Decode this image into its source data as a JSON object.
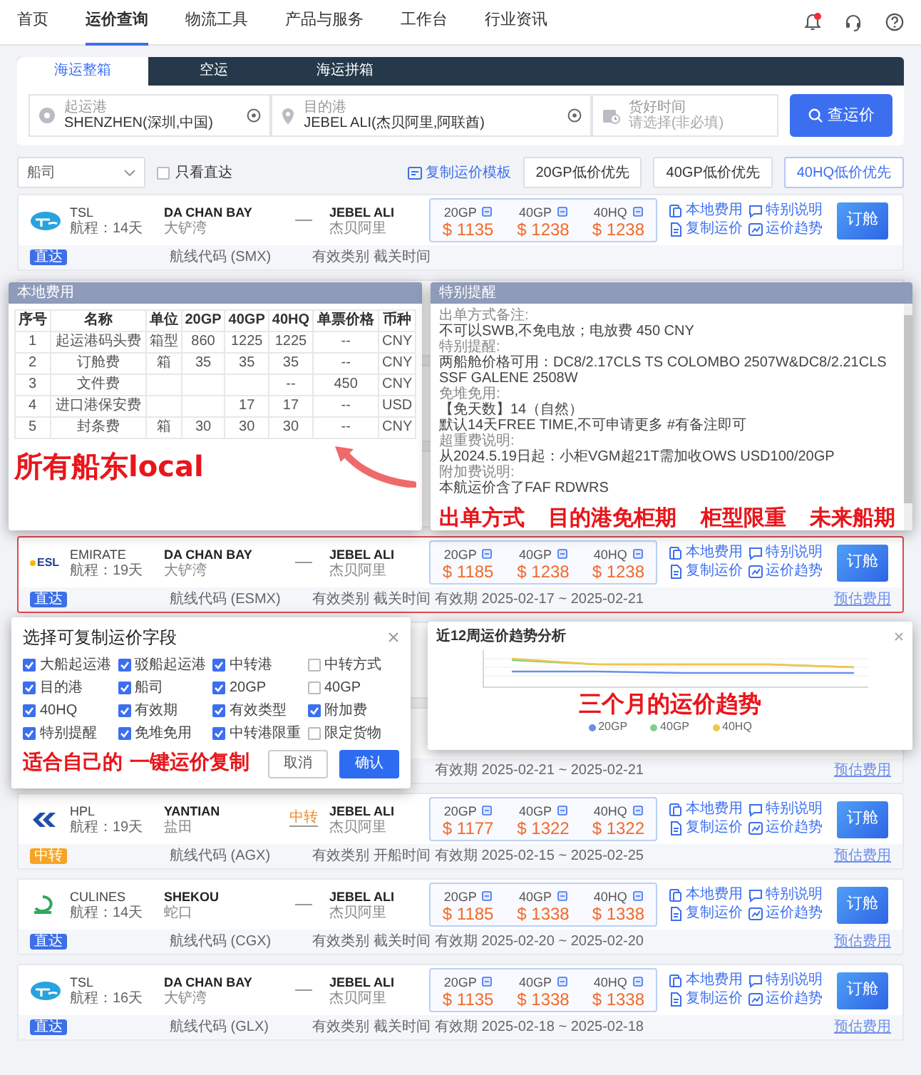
{
  "nav": {
    "items": [
      {
        "label": "首页",
        "selected": false
      },
      {
        "label": "运价查询",
        "selected": true
      },
      {
        "label": "物流工具",
        "selected": false
      },
      {
        "label": "产品与服务",
        "selected": false
      },
      {
        "label": "工作台",
        "selected": false
      },
      {
        "label": "行业资讯",
        "selected": false
      }
    ],
    "bell_badge": true
  },
  "search": {
    "tabs": [
      {
        "label": "海运整箱",
        "selected": true
      },
      {
        "label": "空运",
        "selected": false
      },
      {
        "label": "海运拼箱",
        "selected": false
      }
    ],
    "origin": {
      "label": "起运港",
      "value": "SHENZHEN(深圳,中国)"
    },
    "destination": {
      "label": "目的港",
      "value": "JEBEL ALI(杰贝阿里,阿联酋)"
    },
    "date": {
      "label": "货好时间",
      "placeholder": "请选择(非必填)"
    },
    "button": "查运价"
  },
  "filters": {
    "carrier": {
      "placeholder": "船司"
    },
    "direct_only": {
      "label": "只看直达",
      "checked": false
    },
    "copy_template": "复制运价模板",
    "sort": [
      {
        "label": "20GP低价优先",
        "selected": false
      },
      {
        "label": "40GP低价优先",
        "selected": false
      },
      {
        "label": "40HQ低价优先",
        "selected": true
      }
    ]
  },
  "results": [
    {
      "kind": "full",
      "logo": {
        "kind": "tsl"
      },
      "carrier": "TSL",
      "transit": "航程：14天",
      "from_port": "DA CHAN BAY",
      "from_cn": "大铲湾",
      "to_port": "JEBEL ALI",
      "to_cn": "杰贝阿里",
      "prices": [
        {
          "type": "20GP",
          "amount": "$ 1135"
        },
        {
          "type": "40GP",
          "amount": "$ 1238"
        },
        {
          "type": "40HQ",
          "amount": "$ 1238"
        }
      ],
      "links": [
        "本地费用",
        "特别说明",
        "复制运价",
        "运价趋势"
      ],
      "book": "订舱",
      "tag": {
        "label": "直达",
        "color": "#3d6fe6"
      },
      "route_code": "航线代码 (SMX)",
      "validity_type": "有效类别 截关时间",
      "highlighted": false
    },
    {
      "kind": "covered"
    },
    {
      "kind": "covered"
    },
    {
      "kind": "covered"
    },
    {
      "kind": "full",
      "logo": {
        "kind": "esl",
        "text": "ESL"
      },
      "carrier": "EMIRATE",
      "transit": "航程：19天",
      "from_port": "DA CHAN BAY",
      "from_cn": "大铲湾",
      "to_port": "JEBEL ALI",
      "to_cn": "杰贝阿里",
      "prices": [
        {
          "type": "20GP",
          "amount": "$ 1185"
        },
        {
          "type": "40GP",
          "amount": "$ 1238"
        },
        {
          "type": "40HQ",
          "amount": "$ 1238"
        }
      ],
      "links": [
        "本地费用",
        "特别说明",
        "复制运价",
        "运价趋势"
      ],
      "book": "订舱",
      "tag": {
        "label": "直达",
        "color": "#3d6fe6"
      },
      "route_code": "航线代码 (ESMX)",
      "validity_type": "有效类别 截关时间",
      "validity": "有效期 2025-02-17 ~ 2025-02-21",
      "estimate": "预估费用",
      "highlighted": true
    },
    {
      "kind": "covered"
    },
    {
      "kind": "partial",
      "validity": "有效期 2025-02-21 ~ 2025-02-21",
      "estimate": "预估费用"
    },
    {
      "kind": "full",
      "logo": {
        "kind": "hpl"
      },
      "carrier": "HPL",
      "transit": "航程：19天",
      "from_port": "YANTIAN",
      "from_cn": "盐田",
      "transfer": "中转",
      "to_port": "JEBEL ALI",
      "to_cn": "杰贝阿里",
      "prices": [
        {
          "type": "20GP",
          "amount": "$ 1177"
        },
        {
          "type": "40GP",
          "amount": "$ 1322"
        },
        {
          "type": "40HQ",
          "amount": "$ 1322"
        }
      ],
      "links": [
        "本地费用",
        "特别说明",
        "复制运价",
        "运价趋势"
      ],
      "book": "订舱",
      "tag": {
        "label": "中转",
        "color": "#f5a524"
      },
      "route_code": "航线代码 (AGX)",
      "validity_type": "有效类别 开船时间",
      "validity": "有效期 2025-02-15 ~ 2025-02-25",
      "estimate": "预估费用",
      "highlighted": false
    },
    {
      "kind": "full",
      "logo": {
        "kind": "culines"
      },
      "carrier": "CULINES",
      "transit": "航程：14天",
      "from_port": "SHEKOU",
      "from_cn": "蛇口",
      "to_port": "JEBEL ALI",
      "to_cn": "杰贝阿里",
      "prices": [
        {
          "type": "20GP",
          "amount": "$ 1185"
        },
        {
          "type": "40GP",
          "amount": "$ 1338"
        },
        {
          "type": "40HQ",
          "amount": "$ 1338"
        }
      ],
      "links": [
        "本地费用",
        "特别说明",
        "复制运价",
        "运价趋势"
      ],
      "book": "订舱",
      "tag": {
        "label": "直达",
        "color": "#3d6fe6"
      },
      "route_code": "航线代码 (CGX)",
      "validity_type": "有效类别 截关时间",
      "validity": "有效期 2025-02-20 ~ 2025-02-20",
      "estimate": "预估费用",
      "highlighted": false
    },
    {
      "kind": "full",
      "logo": {
        "kind": "tsl"
      },
      "carrier": "TSL",
      "transit": "航程：16天",
      "from_port": "DA CHAN BAY",
      "from_cn": "大铲湾",
      "to_port": "JEBEL ALI",
      "to_cn": "杰贝阿里",
      "prices": [
        {
          "type": "20GP",
          "amount": "$ 1135"
        },
        {
          "type": "40GP",
          "amount": "$ 1338"
        },
        {
          "type": "40HQ",
          "amount": "$ 1338"
        }
      ],
      "links": [
        "本地费用",
        "特别说明",
        "复制运价",
        "运价趋势"
      ],
      "book": "订舱",
      "tag": {
        "label": "直达",
        "color": "#3d6fe6"
      },
      "route_code": "航线代码 (GLX)",
      "validity_type": "有效类别 截关时间",
      "validity": "有效期 2025-02-18 ~ 2025-02-18",
      "estimate": "预估费用",
      "highlighted": false
    }
  ],
  "local_fees": {
    "title": "本地费用",
    "columns": [
      "序号",
      "名称",
      "单位",
      "20GP",
      "40GP",
      "40HQ",
      "单票价格",
      "币种"
    ],
    "rows": [
      [
        "1",
        "起运港码头费",
        "箱型",
        "860",
        "1225",
        "1225",
        "--",
        "CNY"
      ],
      [
        "2",
        "订舱费",
        "箱",
        "35",
        "35",
        "35",
        "--",
        "CNY"
      ],
      [
        "3",
        "文件费",
        null,
        null,
        null,
        "--",
        "450",
        "CNY"
      ],
      [
        "4",
        "进口港保安费",
        null,
        null,
        "17",
        "17",
        "--",
        "USD"
      ],
      [
        "5",
        "封条费",
        "箱",
        "30",
        "30",
        "30",
        "--",
        "CNY"
      ]
    ],
    "annotation": "所有船东local"
  },
  "special_notes": {
    "title": "特别提醒",
    "sections": [
      {
        "label": "出单方式备注:",
        "lines": [
          "不可以SWB,不免电放；电放费 450 CNY"
        ]
      },
      {
        "label": "特别提醒:",
        "lines": [
          "两船舱价格可用：DC8/2.17CLS TS COLOMBO 2507W&DC8/2.21CLS SSF GALENE 2508W"
        ]
      },
      {
        "label": "免堆免用:",
        "lines": [
          "【免天数】14（自然）",
          "默认14天FREE TIME,不可申请更多 #有备注即可"
        ]
      },
      {
        "label": "超重费说明:",
        "lines": [
          "从2024.5.19日起：小柜VGM超21T需加收OWS USD100/20GP"
        ]
      },
      {
        "label": "附加费说明:",
        "lines": [
          "本航运价含了FAF RDWRS"
        ]
      }
    ],
    "annotations": [
      "出单方式",
      "目的港免柜期",
      "柜型限重",
      "未来船期"
    ]
  },
  "copy_dialog": {
    "title": "选择可复制运价字段",
    "fields": [
      {
        "label": "大船起运港",
        "checked": true
      },
      {
        "label": "驳船起运港",
        "checked": true
      },
      {
        "label": "中转港",
        "checked": true
      },
      {
        "label": "中转方式",
        "checked": false
      },
      {
        "label": "目的港",
        "checked": true
      },
      {
        "label": "船司",
        "checked": true
      },
      {
        "label": "20GP",
        "checked": true
      },
      {
        "label": "40GP",
        "checked": false
      },
      {
        "label": "40HQ",
        "checked": true
      },
      {
        "label": "有效期",
        "checked": true
      },
      {
        "label": "有效类型",
        "checked": true
      },
      {
        "label": "附加费",
        "checked": true
      },
      {
        "label": "特别提醒",
        "checked": true
      },
      {
        "label": "免堆免用",
        "checked": true
      },
      {
        "label": "中转港限重",
        "checked": true
      },
      {
        "label": "限定货物",
        "checked": false
      }
    ],
    "annotation": [
      "适合自己的",
      "一键运价复制"
    ],
    "cancel": "取消",
    "confirm": "确认"
  },
  "trend_chart": {
    "title": "近12周运价趋势分析",
    "legend": [
      {
        "label": "20GP",
        "color": "#6b8ee8"
      },
      {
        "label": "40GP",
        "color": "#7fcf8c"
      },
      {
        "label": "40HQ",
        "color": "#f3c64a"
      }
    ],
    "annotation": "三个月的运价趋势"
  }
}
